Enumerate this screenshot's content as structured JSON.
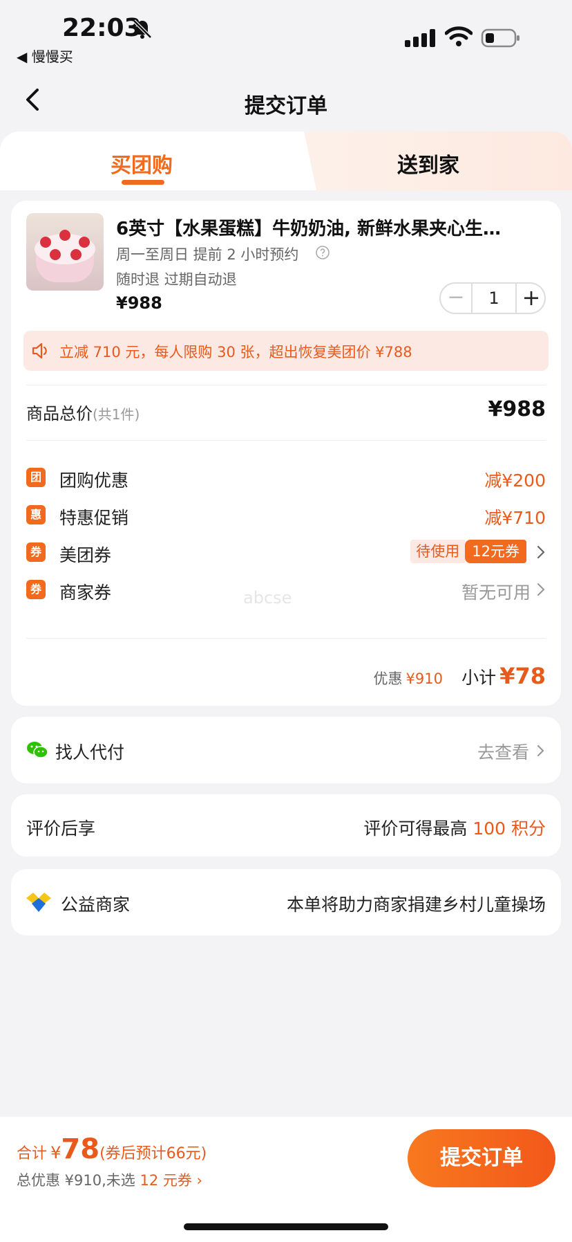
{
  "status": {
    "time": "22:03",
    "back_app": "◀ 慢慢买"
  },
  "nav": {
    "title": "提交订单"
  },
  "tabs": {
    "left": "买团购",
    "right": "送到家"
  },
  "product": {
    "title": "6英寸【水果蛋糕】牛奶奶油, 新鲜水果夹心生…",
    "booking": "周一至周日 提前 2 小时预约",
    "refund": "随时退 过期自动退",
    "price": "¥988",
    "quantity": "1"
  },
  "notice": {
    "text": "立减 710 元，每人限购 30 张，超出恢复美团价 ¥788"
  },
  "summary": {
    "total_label": "商品总价",
    "total_count": "(共1件)",
    "total_value": "¥988",
    "group_icon": "团",
    "group_label": "团购优惠",
    "group_value": "减¥200",
    "promo_icon": "惠",
    "promo_label": "特惠促销",
    "promo_value": "减¥710",
    "mt_coupon_icon": "券",
    "mt_coupon_label": "美团券",
    "mt_coupon_pending": "待使用",
    "mt_coupon_amount": "12元券",
    "shop_coupon_icon": "券",
    "shop_coupon_label": "商家券",
    "shop_coupon_value": "暂无可用",
    "discount_label": "优惠",
    "discount_value": "¥910",
    "subtotal_label": "小计",
    "subtotal_value": "¥78"
  },
  "watermark": "abcse",
  "pay_for_me": {
    "label": "找人代付",
    "link": "去查看"
  },
  "review": {
    "label": "评价后享",
    "text": "评价可得最高",
    "points": "100 积分"
  },
  "charity": {
    "label": "公益商家",
    "text": "本单将助力商家捐建乡村儿童操场"
  },
  "bottom": {
    "total_label": "合计",
    "currency": "¥",
    "total_value": "78",
    "total_note": "(券后预计66元)",
    "save_text": "总优惠 ¥910,未选",
    "save_coupon": "12 元券 ›",
    "submit": "提交订单"
  },
  "colors": {
    "accent": "#f26a1d",
    "accent_text": "#e85a1c",
    "background": "#f3f3f5"
  }
}
